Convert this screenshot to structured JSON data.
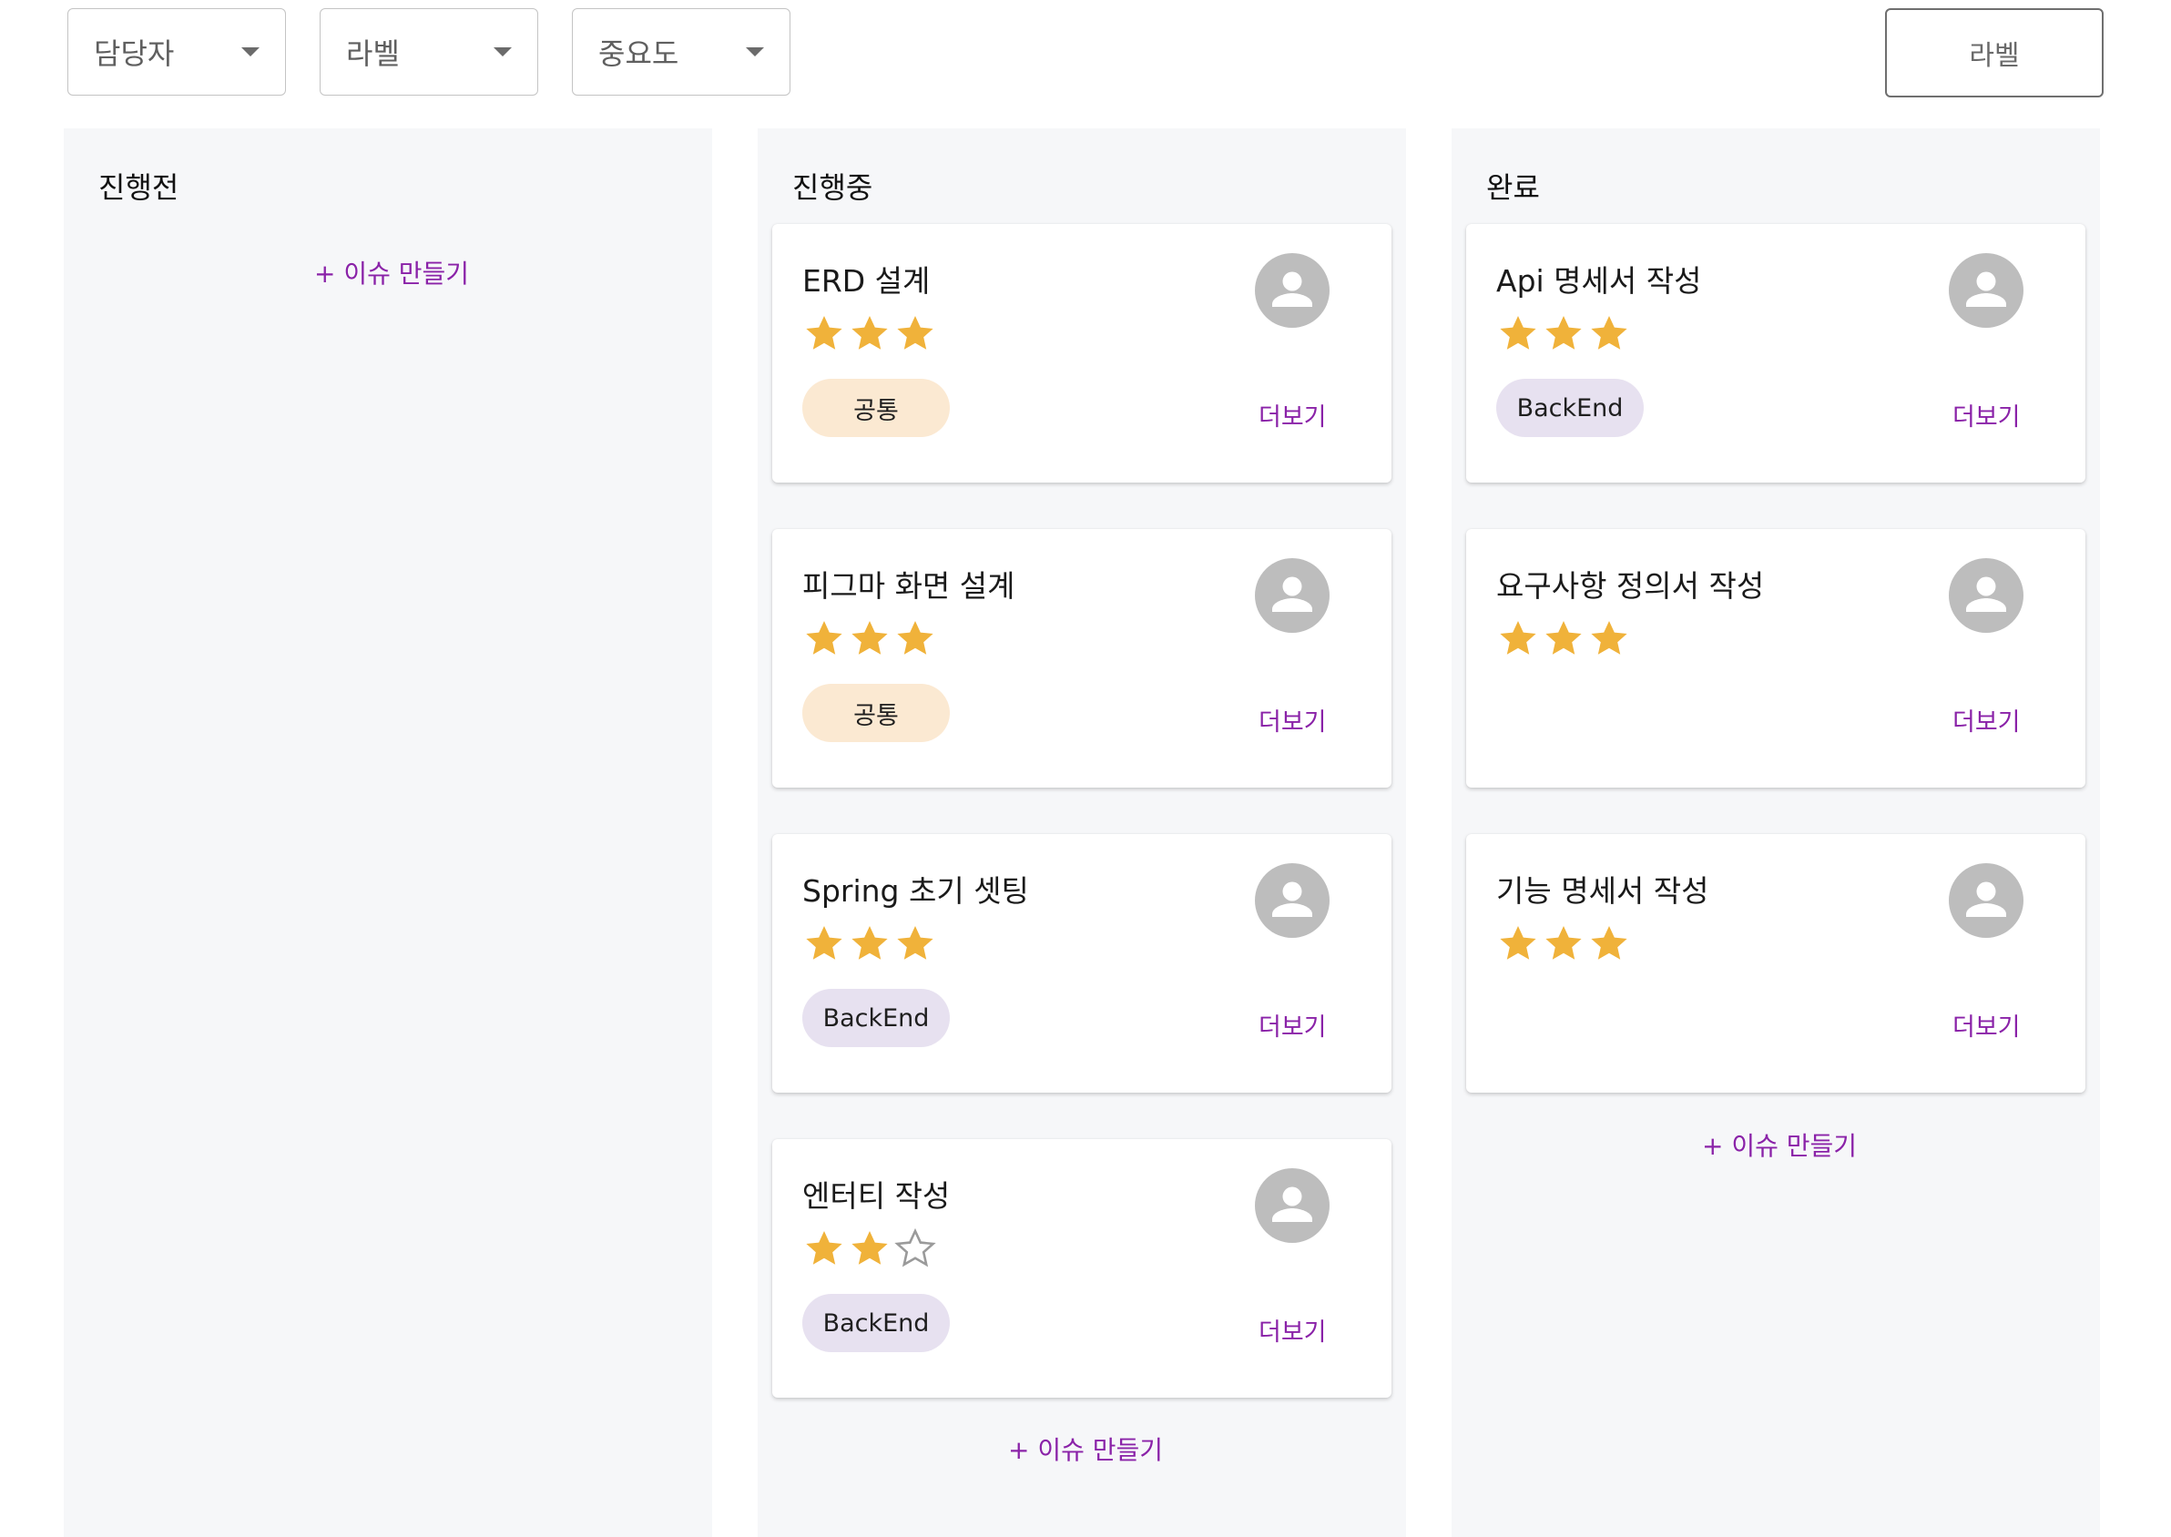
{
  "filters": {
    "assignee": "담당자",
    "label": "라벨",
    "priority": "중요도"
  },
  "label_button": "라벨",
  "columns": [
    {
      "title": "진행전",
      "add_issue": "+ 이슈 만들기",
      "cards": []
    },
    {
      "title": "진행중",
      "add_issue": "+ 이슈 만들기",
      "cards": [
        {
          "title": "ERD 설계",
          "stars": 3,
          "tag": "공통",
          "tag_color": "#fbe9d2",
          "more": "더보기"
        },
        {
          "title": "피그마 화면 설계",
          "stars": 3,
          "tag": "공통",
          "tag_color": "#fbe9d2",
          "more": "더보기"
        },
        {
          "title": "Spring 초기 셋팅",
          "stars": 3,
          "tag": "BackEnd",
          "tag_color": "#e7e1f0",
          "more": "더보기"
        },
        {
          "title": "엔터티 작성",
          "stars": 2,
          "tag": "BackEnd",
          "tag_color": "#e7e1f0",
          "more": "더보기"
        }
      ]
    },
    {
      "title": "완료",
      "add_issue": "+ 이슈 만들기",
      "cards": [
        {
          "title": "Api 명세서 작성",
          "stars": 3,
          "tag": "BackEnd",
          "tag_color": "#e7e1f0",
          "more": "더보기"
        },
        {
          "title": "요구사항 정의서 작성",
          "stars": 3,
          "tag": "",
          "tag_color": "",
          "more": "더보기"
        },
        {
          "title": "기능 명세서 작성",
          "stars": 3,
          "tag": "",
          "tag_color": "",
          "more": "더보기"
        }
      ]
    }
  ],
  "colors": {
    "accent": "#8a22a8",
    "star": "#f0b23a",
    "column_bg": "#f6f7f9",
    "avatar": "#bdbdbd"
  },
  "icons": {
    "dropdown": "chevron-down-icon",
    "avatar": "person-icon",
    "rating": "star-icon"
  }
}
